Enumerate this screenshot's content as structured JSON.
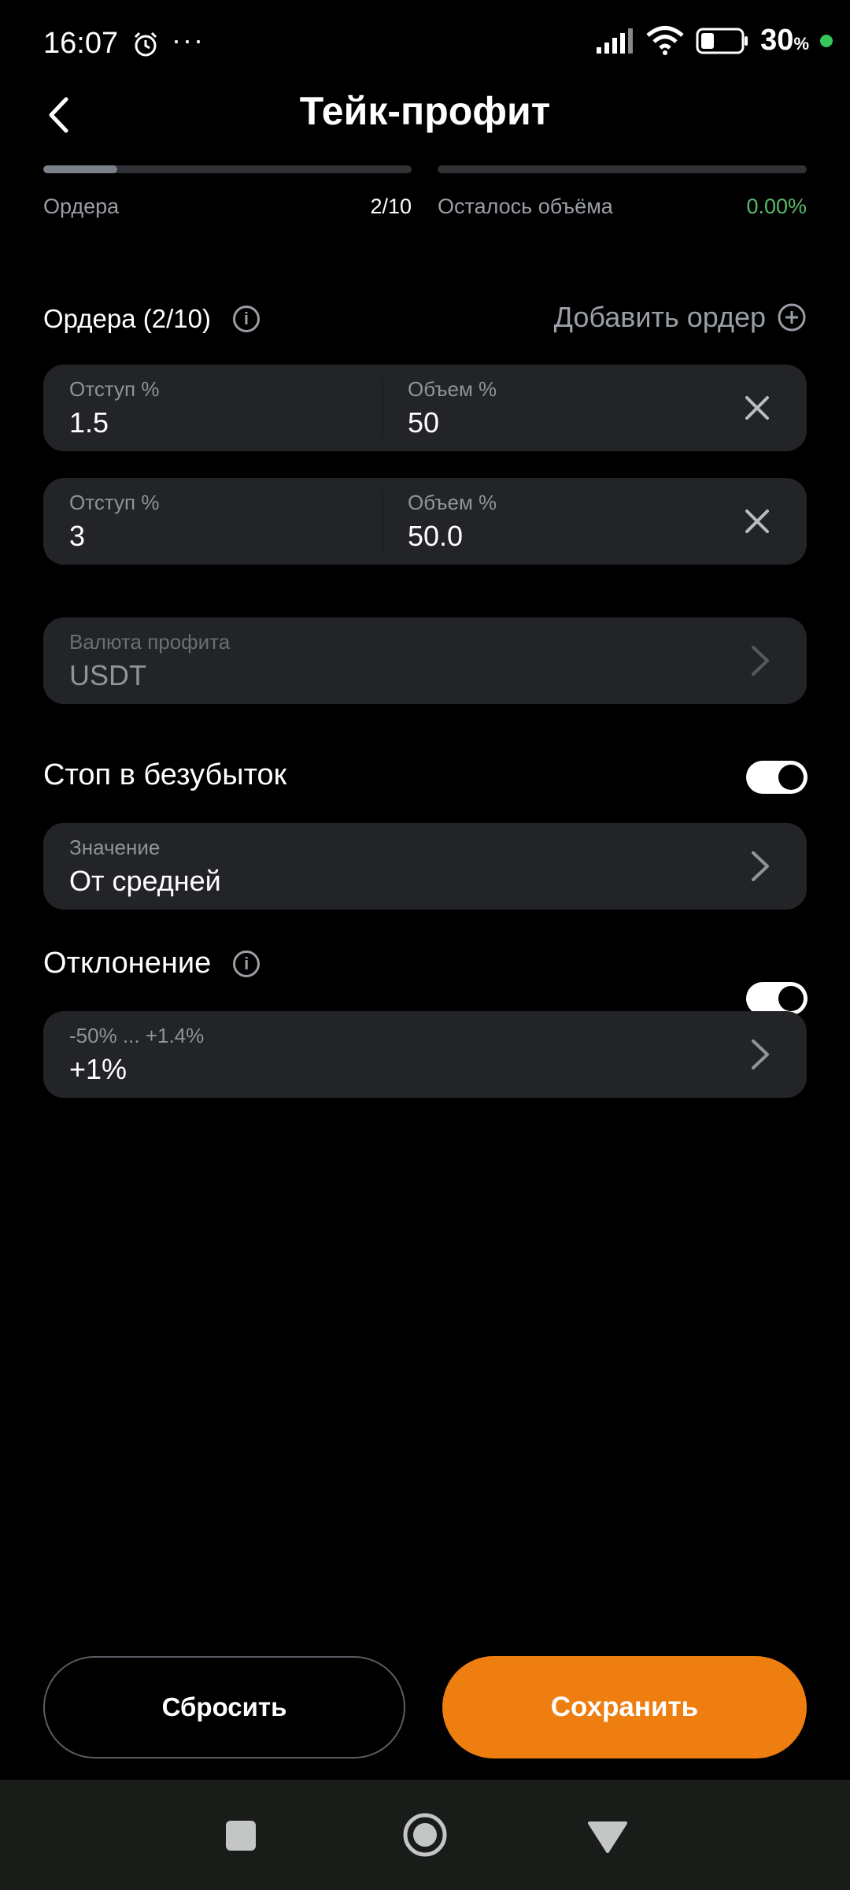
{
  "status_bar": {
    "time": "16:07",
    "more": "···",
    "battery": "30",
    "battery_unit": "%",
    "icons": [
      "alarm-icon",
      "signal-icon",
      "wifi-icon",
      "battery-icon"
    ]
  },
  "header": {
    "title": "Тейк-профит",
    "back_icon": "chevron-left-icon"
  },
  "progress": {
    "orders": {
      "label": "Ордера",
      "value": "2/10",
      "fraction": 0.2
    },
    "remaining": {
      "label": "Осталось объёма",
      "value": "0.00%",
      "fraction": 0
    }
  },
  "orders_section": {
    "title": "Ордера (2/10)",
    "add_label": "Добавить ордер",
    "orders": [
      {
        "offset_label": "Отступ %",
        "offset_value": "1.5",
        "volume_label": "Объем %",
        "volume_value": "50"
      },
      {
        "offset_label": "Отступ %",
        "offset_value": "3",
        "volume_label": "Объем %",
        "volume_value": "50.0"
      }
    ]
  },
  "profit_currency": {
    "label": "Валюта профита",
    "value": "USDT"
  },
  "breakeven": {
    "title": "Стоп в безубыток",
    "enabled": true,
    "value_label": "Значение",
    "value": "От средней"
  },
  "deviation": {
    "title": "Отклонение",
    "enabled": true,
    "range_label": "-50% ... +1.4%",
    "value": "+1%"
  },
  "buttons": {
    "reset": "Сбросить",
    "save": "Сохранить"
  },
  "colors": {
    "accent": "#ee7e10",
    "positive": "#5ab96a",
    "card": "#232427"
  }
}
